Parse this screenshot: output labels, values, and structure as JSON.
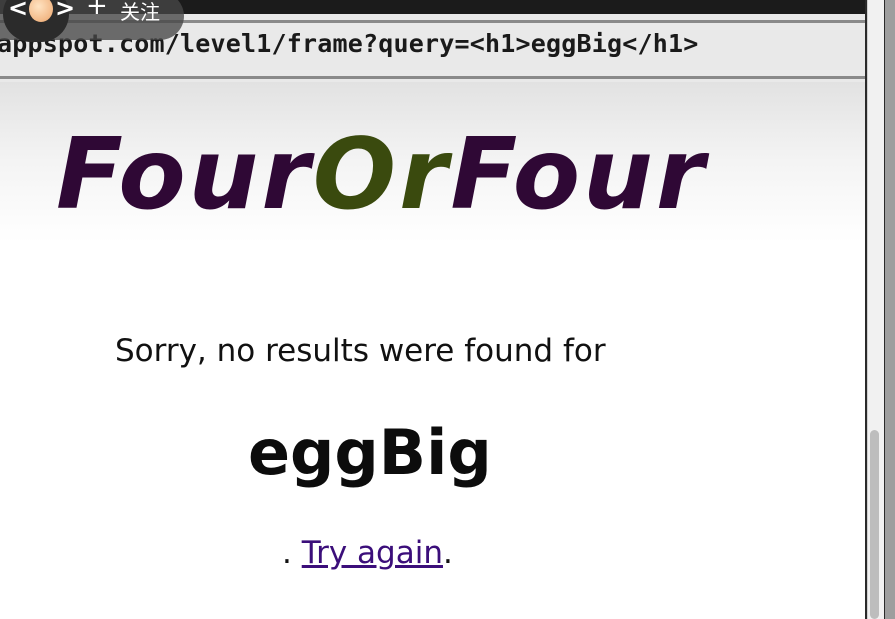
{
  "browser": {
    "url": "appspot.com/level1/frame?query=<h1>eggBig</h1>"
  },
  "overlay": {
    "back_icon": "chevron-left-icon",
    "forward_icon": "chevron-right-icon",
    "plus_glyph": "+",
    "follow_label": "关注"
  },
  "page": {
    "logo": {
      "part1": "Four",
      "part2": "Or",
      "part3": "Four",
      "colors": {
        "four": "#2f0835",
        "or": "#3a4a0e"
      }
    },
    "message": "Sorry, no results were found for",
    "query_heading": "eggBig",
    "try_prefix": ". ",
    "try_again_label": "Try again",
    "try_suffix": "."
  },
  "colors": {
    "link": "#3b0e7a",
    "toolbar": "#e9e9e9",
    "top_strip": "#1b1b1b"
  }
}
